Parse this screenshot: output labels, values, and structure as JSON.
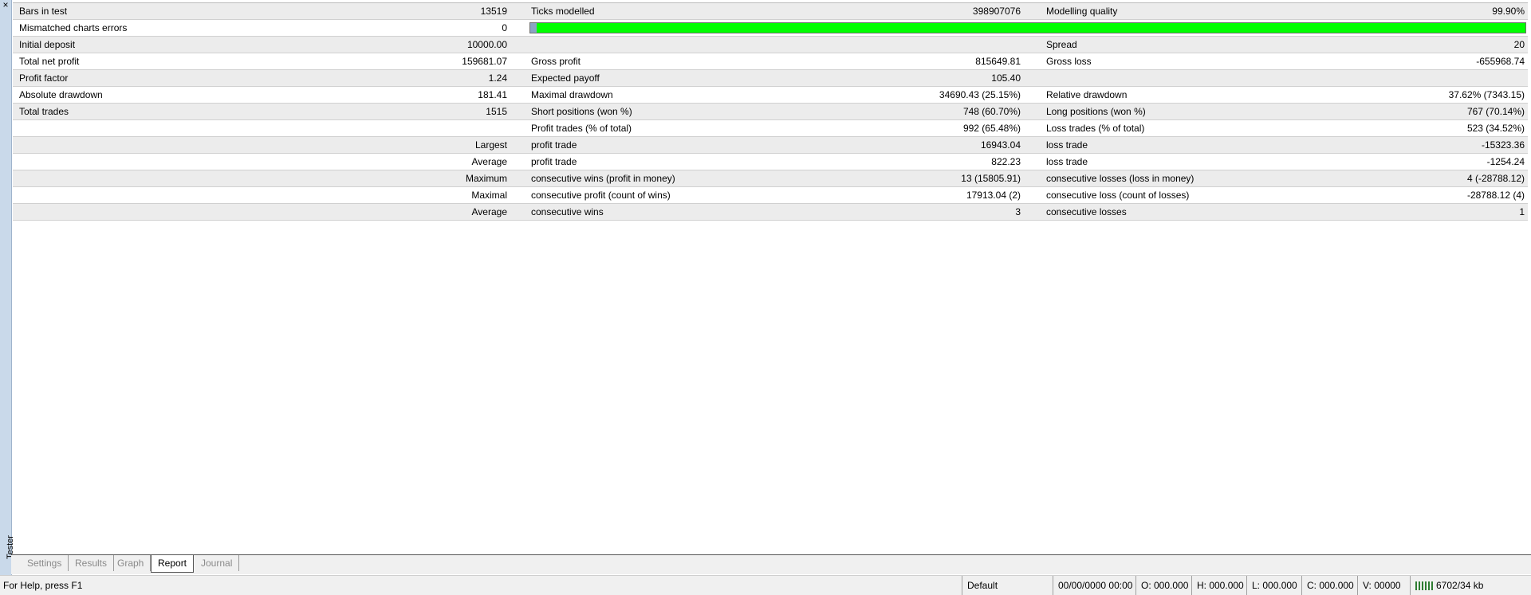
{
  "window": {
    "side_label": "Tester",
    "close_glyph": "×"
  },
  "report": {
    "rows": [
      {
        "l1": "Bars in test",
        "v1": "13519",
        "l2": "Ticks modelled",
        "v2": "398907076",
        "l3": "Modelling quality",
        "v3": "99.90%"
      },
      {
        "l1": "Mismatched charts errors",
        "v1": "0",
        "l2": "",
        "v2": "",
        "l3": "",
        "v3": ""
      },
      {
        "l1": "Initial deposit",
        "v1": "10000.00",
        "l2": "",
        "v2": "",
        "l3": "Spread",
        "v3": "20"
      },
      {
        "l1": "Total net profit",
        "v1": "159681.07",
        "l2": "Gross profit",
        "v2": "815649.81",
        "l3": "Gross loss",
        "v3": "-655968.74"
      },
      {
        "l1": "Profit factor",
        "v1": "1.24",
        "l2": "Expected payoff",
        "v2": "105.40",
        "l3": "",
        "v3": ""
      },
      {
        "l1": "Absolute drawdown",
        "v1": "181.41",
        "l2": "Maximal drawdown",
        "v2": "34690.43 (25.15%)",
        "l3": "Relative drawdown",
        "v3": "37.62% (7343.15)"
      },
      {
        "l1": "Total trades",
        "v1": "1515",
        "l2": "Short positions (won %)",
        "v2": "748 (60.70%)",
        "l3": "Long positions (won %)",
        "v3": "767 (70.14%)"
      },
      {
        "l1": "",
        "v1": "",
        "l2": "Profit trades (% of total)",
        "v2": "992 (65.48%)",
        "l3": "Loss trades (% of total)",
        "v3": "523 (34.52%)"
      },
      {
        "l1": "",
        "v1": "Largest",
        "l2": "profit trade",
        "v2": "16943.04",
        "l3": "loss trade",
        "v3": "-15323.36"
      },
      {
        "l1": "",
        "v1": "Average",
        "l2": "profit trade",
        "v2": "822.23",
        "l3": "loss trade",
        "v3": "-1254.24"
      },
      {
        "l1": "",
        "v1": "Maximum",
        "l2": "consecutive wins (profit in money)",
        "v2": "13 (15805.91)",
        "l3": "consecutive losses (loss in money)",
        "v3": "4 (-28788.12)"
      },
      {
        "l1": "",
        "v1": "Maximal",
        "l2": "consecutive profit (count of wins)",
        "v2": "17913.04 (2)",
        "l3": "consecutive loss (count of losses)",
        "v3": "-28788.12 (4)"
      },
      {
        "l1": "",
        "v1": "Average",
        "l2": "consecutive wins",
        "v2": "3",
        "l3": "consecutive losses",
        "v3": "1"
      }
    ],
    "quality_bar": {
      "fill_color": "#00ff00"
    }
  },
  "tabs": [
    {
      "label": "Settings",
      "active": false
    },
    {
      "label": "Results",
      "active": false
    },
    {
      "label": "Graph",
      "active": false
    },
    {
      "label": "Report",
      "active": true
    },
    {
      "label": "Journal",
      "active": false
    }
  ],
  "status_bar": {
    "help": "For Help, press F1",
    "profile": "Default",
    "datetime": "00/00/0000 00:00",
    "open": "O: 000.000",
    "high": "H: 000.000",
    "low": "L: 000.000",
    "close": "C: 000.000",
    "volume": "V: 00000",
    "memory": "6702/34 kb"
  }
}
